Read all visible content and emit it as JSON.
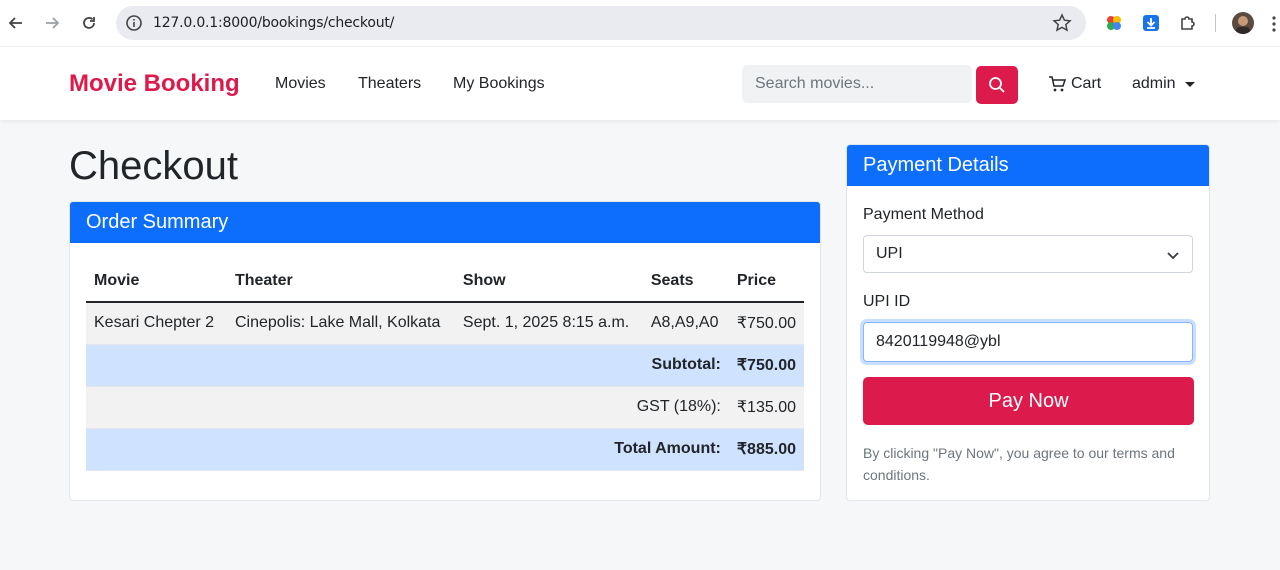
{
  "browser": {
    "url": "127.0.0.1:8000/bookings/checkout/"
  },
  "navbar": {
    "brand": "Movie Booking",
    "links": [
      "Movies",
      "Theaters",
      "My Bookings"
    ],
    "search_placeholder": "Search movies...",
    "cart_label": "Cart",
    "user_label": "admin"
  },
  "page": {
    "title": "Checkout"
  },
  "order_summary": {
    "header": "Order Summary",
    "columns": [
      "Movie",
      "Theater",
      "Show",
      "Seats",
      "Price"
    ],
    "row": {
      "movie": "Kesari Chepter 2",
      "theater": "Cinepolis: Lake Mall, Kolkata",
      "show": "Sept. 1, 2025 8:15 a.m.",
      "seats": "A8,A9,A0",
      "price": "₹750.00"
    },
    "subtotal_label": "Subtotal:",
    "subtotal_value": "₹750.00",
    "gst_label": "GST (18%):",
    "gst_value": "₹135.00",
    "total_label": "Total Amount:",
    "total_value": "₹885.00"
  },
  "payment": {
    "header": "Payment Details",
    "method_label": "Payment Method",
    "method_value": "UPI",
    "upi_label": "UPI ID",
    "upi_value": "8420119948@ybl",
    "pay_button": "Pay Now",
    "terms": "By clicking \"Pay Now\", you agree to our terms and conditions."
  },
  "colors": {
    "brand": "#dc1a4c",
    "primary": "#0d6efd",
    "table_highlight": "#cfe2ff"
  }
}
